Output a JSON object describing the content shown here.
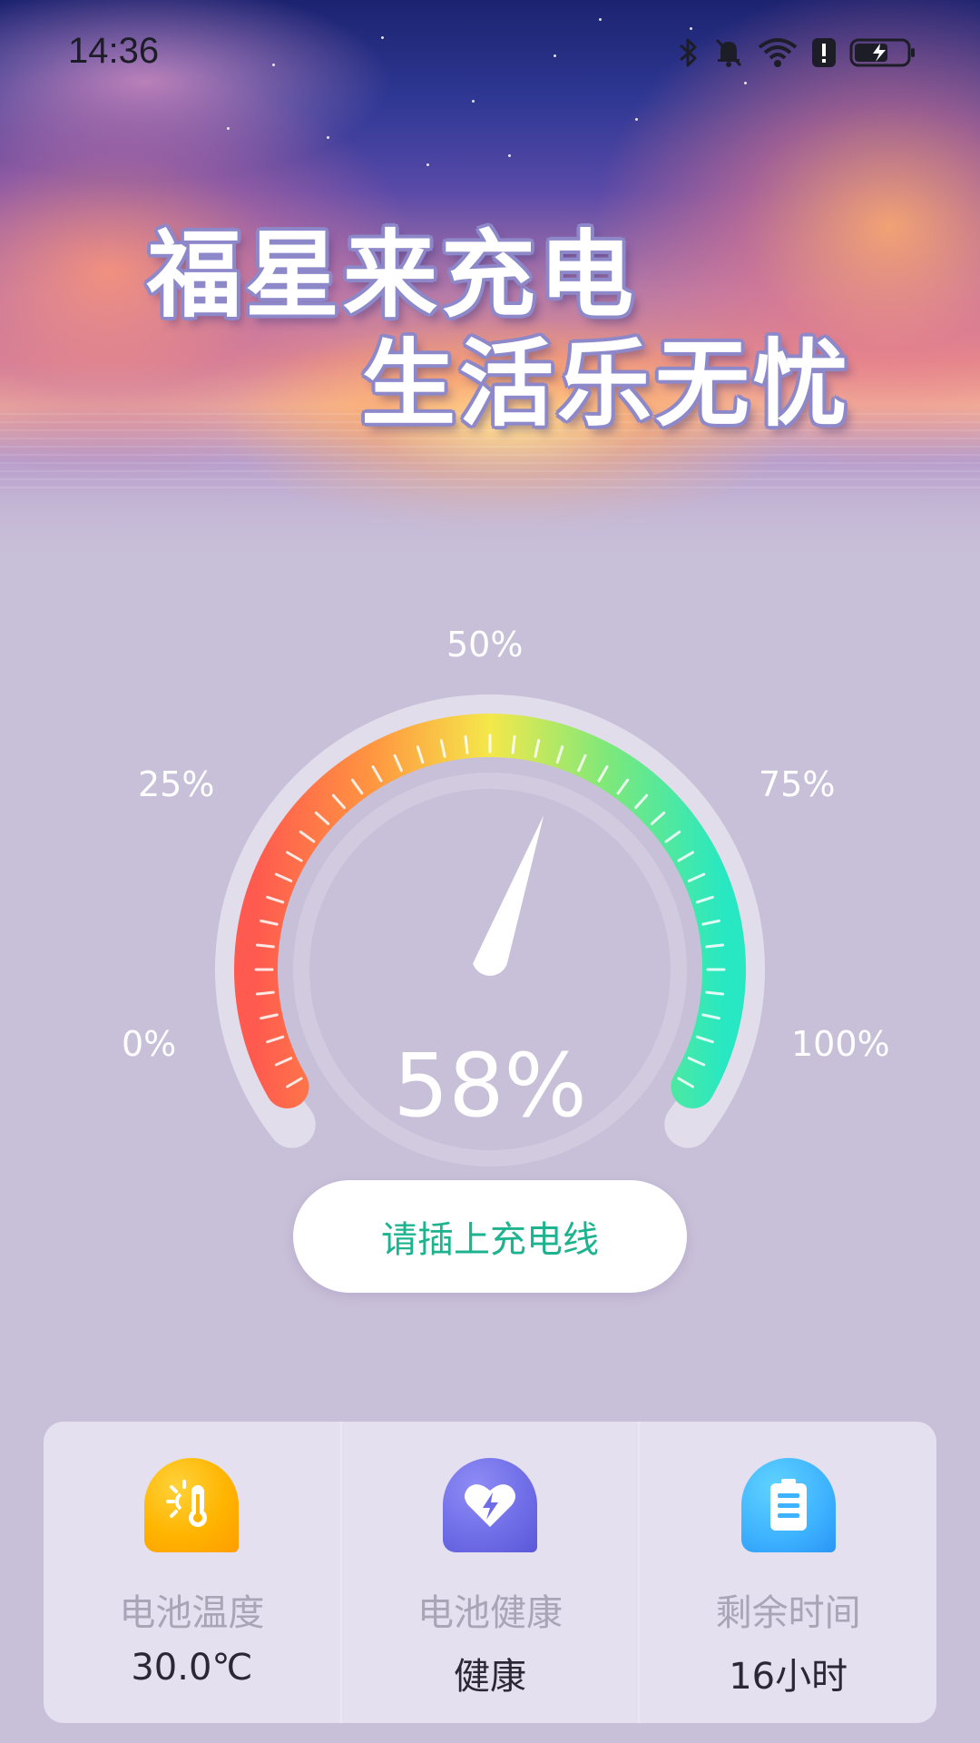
{
  "status_bar": {
    "time": "14:36",
    "icons": [
      "bluetooth-icon",
      "bell-muted-icon",
      "wifi-icon",
      "alert-icon",
      "battery-charging-icon"
    ]
  },
  "banner": {
    "line1": "福星来充电",
    "line2": "生活乐无忧"
  },
  "gauge": {
    "label_0": "0%",
    "label_25": "25%",
    "label_50": "50%",
    "label_75": "75%",
    "label_100": "100%",
    "level": 58,
    "percent_text": "58%",
    "colors": {
      "low": "#ff5a4f",
      "mid": "#f4e84a",
      "high": "#27e8c2",
      "track": "#e6e2ef",
      "needle": "#ffffff"
    }
  },
  "charge_button": {
    "label": "请插上充电线",
    "color": "#1db38f"
  },
  "info_card": {
    "items": [
      {
        "icon": "thermometer-sun-icon",
        "title": "电池温度",
        "value": "30.0℃"
      },
      {
        "icon": "heart-bolt-icon",
        "title": "电池健康",
        "value": "健康"
      },
      {
        "icon": "battery-icon",
        "title": "剩余时间",
        "value": "16小时"
      }
    ]
  }
}
